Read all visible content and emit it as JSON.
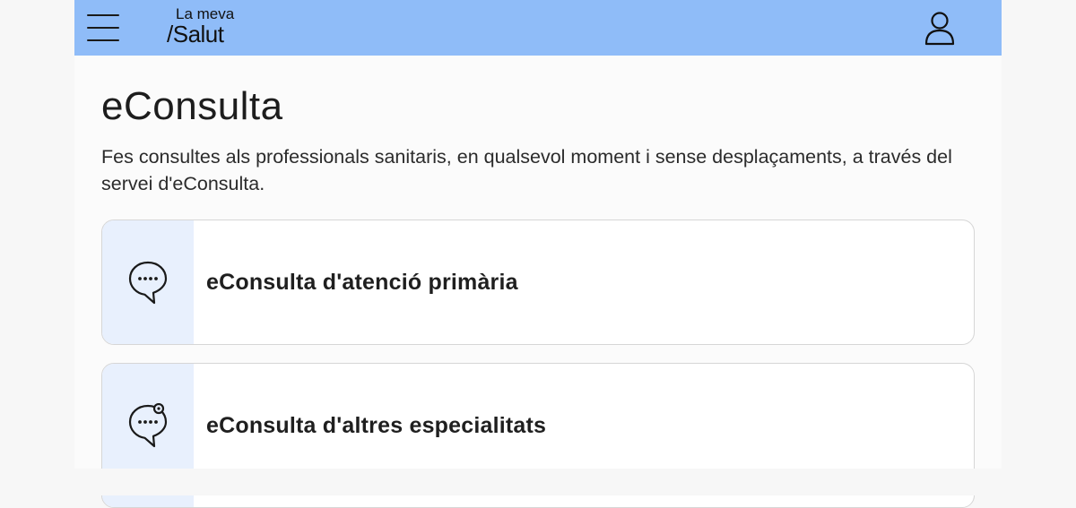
{
  "header": {
    "logo_top": "La meva",
    "logo_bottom": "/Salut",
    "menu_icon": "hamburger-menu-icon",
    "user_icon": "user-icon",
    "background_color": "#8fbcf8"
  },
  "main": {
    "title": "eConsulta",
    "description": "Fes consultes als professionals sanitaris, en qualsevol moment i sense desplaçaments, a través del servei d'eConsulta.",
    "cards": [
      {
        "label": "eConsulta d'atenció primària",
        "icon": "chat-bubble-icon"
      },
      {
        "label": "eConsulta d'altres especialitats",
        "icon": "chat-bubble-specialist-icon"
      }
    ]
  }
}
